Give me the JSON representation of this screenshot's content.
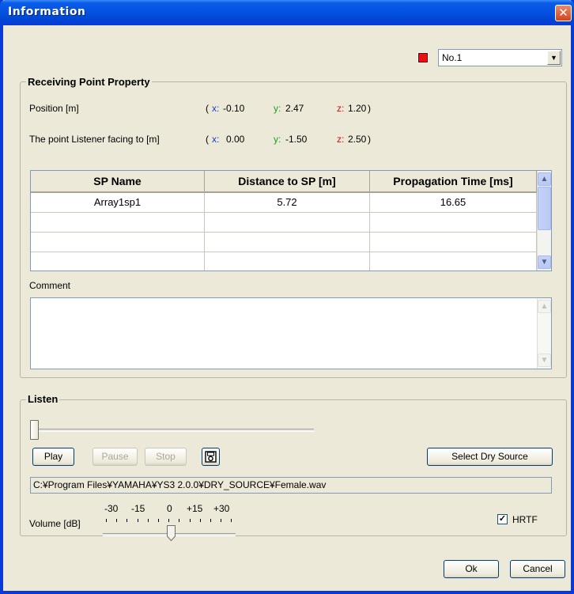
{
  "window": {
    "title": "Information",
    "close_glyph": "✕"
  },
  "selector": {
    "value": "No.1",
    "marker_color": "#e81010"
  },
  "receiving_point": {
    "group_title": "Receiving Point Property",
    "position": {
      "label": "Position [m]",
      "open": "(",
      "x_label": "x:",
      "x": "-0.10",
      "y_label": "y:",
      "y": "2.47",
      "z_label": "z:",
      "z": "1.20",
      "close": ")"
    },
    "facing": {
      "label": "The point Listener facing to [m]",
      "open": "(",
      "x_label": "x:",
      "x": "0.00",
      "y_label": "y:",
      "y": "-1.50",
      "z_label": "z:",
      "z": "2.50",
      "close": ")"
    }
  },
  "table": {
    "headers": [
      "SP Name",
      "Distance to SP [m]",
      "Propagation Time [ms]"
    ],
    "rows": [
      [
        "Array1sp1",
        "5.72",
        "16.65"
      ],
      [
        "",
        "",
        ""
      ],
      [
        "",
        "",
        ""
      ],
      [
        "",
        "",
        ""
      ]
    ]
  },
  "comment": {
    "label": "Comment",
    "value": ""
  },
  "listen": {
    "group_title": "Listen",
    "play_label": "Play",
    "pause_label": "Pause",
    "stop_label": "Stop",
    "select_dry_source_label": "Select Dry Source",
    "file_path": "C:¥Program Files¥YAMAHA¥YS3 2.0.0¥DRY_SOURCE¥Female.wav",
    "volume_label": "Volume [dB]",
    "volume_ticks": [
      "-30",
      "-15",
      "0",
      "+15",
      "+30"
    ],
    "volume_db": 0,
    "position_fraction": 0,
    "hrtf_label": "HRTF",
    "hrtf_checked": true
  },
  "footer": {
    "ok_label": "Ok",
    "cancel_label": "Cancel"
  }
}
